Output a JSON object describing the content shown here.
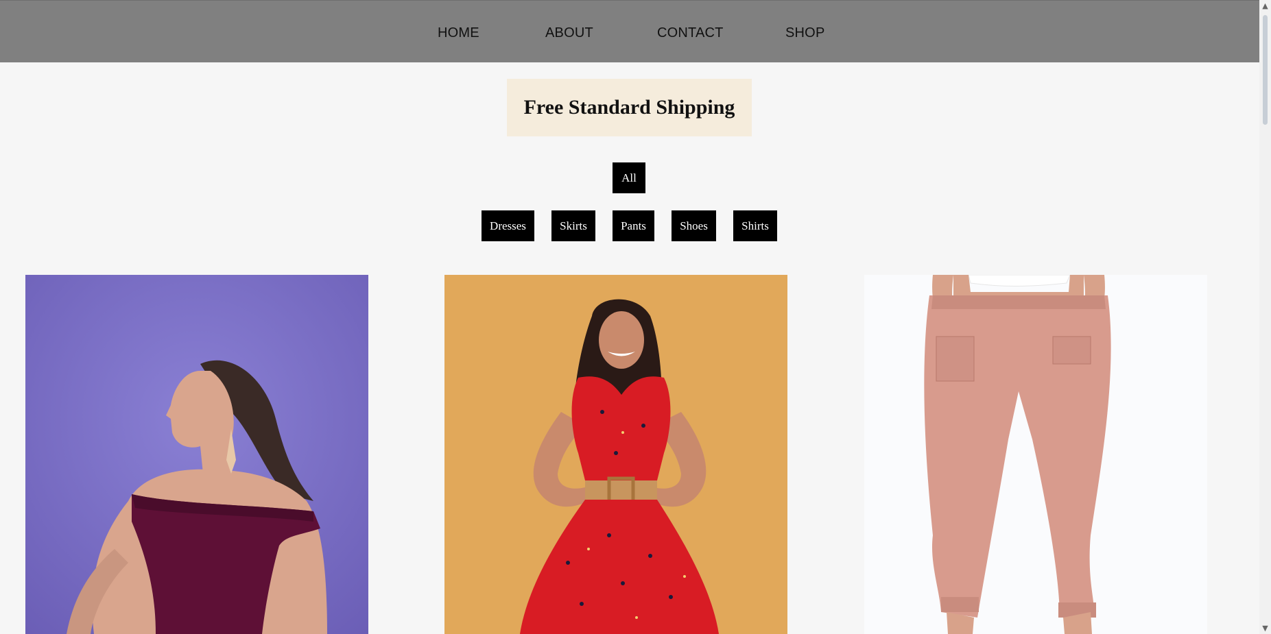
{
  "nav": {
    "items": [
      {
        "label": "HOME"
      },
      {
        "label": "ABOUT"
      },
      {
        "label": "CONTACT"
      },
      {
        "label": "SHOP"
      }
    ]
  },
  "banner": {
    "text": "Free Standard Shipping"
  },
  "filters": {
    "all": "All",
    "categories": [
      "Dresses",
      "Skirts",
      "Pants",
      "Shoes",
      "Shirts"
    ]
  },
  "products": [
    {
      "image": "woman-purple-off-shoulder-dress-photo",
      "background": "#7d70c4"
    },
    {
      "image": "woman-red-floral-dress-photo",
      "background": "#e1a85a"
    },
    {
      "image": "pink-jogger-pants-photo",
      "background": "#fafbfd"
    }
  ],
  "scrollbar": {
    "up_icon": "chevron-up-icon",
    "down_icon": "chevron-down-icon"
  }
}
